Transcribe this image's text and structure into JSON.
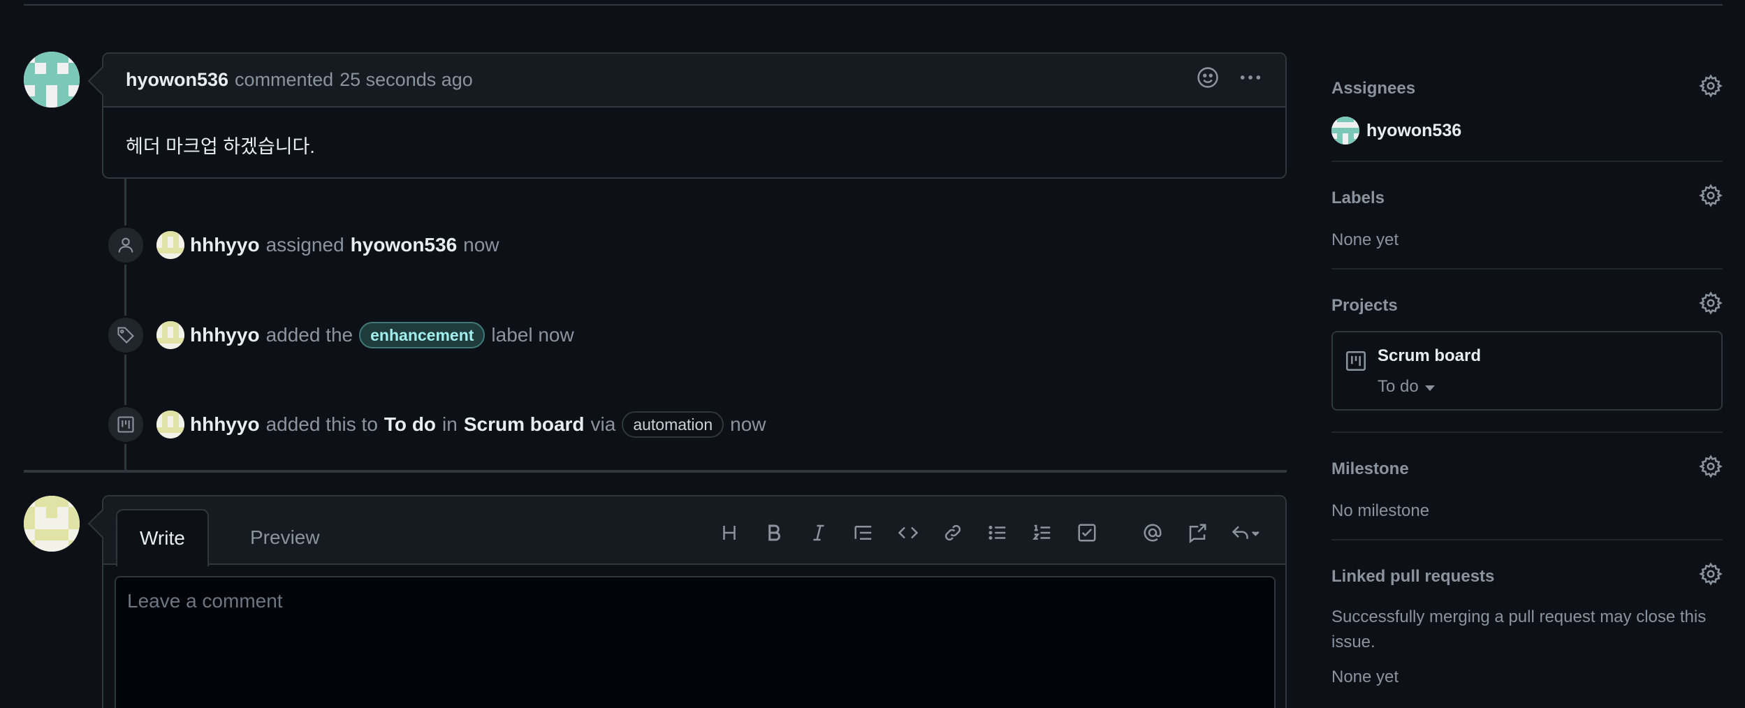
{
  "comment": {
    "author": "hyowon536",
    "action": "commented",
    "time": "25 seconds ago",
    "body": "헤더 마크업 하겠습니다."
  },
  "timeline": [
    {
      "icon": "person-icon",
      "actor": "hhhyyo",
      "verb": "assigned",
      "target": "hyowon536",
      "time": "now"
    },
    {
      "icon": "tag-icon",
      "actor": "hhhyyo",
      "verb": "added the",
      "label": "enhancement",
      "suffix": "label now"
    },
    {
      "icon": "project-icon",
      "actor": "hhhyyo",
      "verb": "added this to",
      "column": "To do",
      "in": "in",
      "project": "Scrum board",
      "via": "via",
      "pill": "automation",
      "time": "now"
    }
  ],
  "editor": {
    "tab_write": "Write",
    "tab_preview": "Preview",
    "placeholder": "Leave a comment",
    "toolbar": [
      "heading-icon",
      "bold-icon",
      "italic-icon",
      "quote-icon",
      "code-icon",
      "link-icon",
      "unordered-list-icon",
      "ordered-list-icon",
      "task-list-icon",
      "mention-icon",
      "cross-reference-icon",
      "reply-icon"
    ]
  },
  "sidebar": {
    "assignees": {
      "title": "Assignees",
      "user": "hyowon536"
    },
    "labels": {
      "title": "Labels",
      "value": "None yet"
    },
    "projects": {
      "title": "Projects",
      "name": "Scrum board",
      "column": "To do"
    },
    "milestone": {
      "title": "Milestone",
      "value": "No milestone"
    },
    "linked": {
      "title": "Linked pull requests",
      "desc": "Successfully merging a pull request may close this issue.",
      "value": "None yet"
    }
  },
  "colors": {
    "background": "#0d1117",
    "label_bg": "#1f3b3b",
    "label_fg": "#a2eeef",
    "avatar_teal": "#7cc8b8",
    "avatar_khaki": "#e0e2a6"
  }
}
